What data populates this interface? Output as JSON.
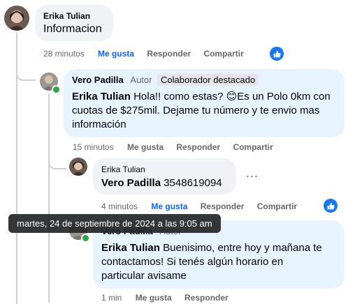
{
  "comments": [
    {
      "author": "Erika Tulian",
      "text": "Informacion",
      "time": "28 minutos",
      "like_label": "Me gusta",
      "reply_label": "Responder",
      "share_label": "Compartir"
    },
    {
      "author": "Vero Padilla",
      "role": "Autor",
      "badge": "Colaborador destacado",
      "mention": "Erika Tulian",
      "text": "Hola!! como estas? 😊Es un Polo 0km con cuotas de $275mil. Dejame tu número y te envio mas información",
      "time": "15 minutos",
      "like_label": "Me gusta",
      "reply_label": "Responder",
      "share_label": "Compartir"
    },
    {
      "author": "Erika Tulian",
      "mention": "Vero Padilla",
      "text": "3548619094",
      "time": "4 minutos",
      "like_label": "Me gusta",
      "reply_label": "Responder",
      "share_label": "Compartir",
      "more": "..."
    },
    {
      "author": "Vero Padilla",
      "role": "Autor",
      "mention": "Erika Tulian",
      "text": "Buenisimo, entre hoy y mañana te contactamos! Si tenés algún horario en particular avisame",
      "time": "1 min",
      "like_label": "Me gusta",
      "reply_label": "Responder"
    }
  ],
  "tooltip": "martes, 24 de septiembre de 2024 a las 9:05 am",
  "colors": {
    "liked": "#0866ff",
    "bubble_gray": "#f0f2f5",
    "bubble_blue": "#e7f3ff",
    "like_icon": "#1877f2"
  }
}
